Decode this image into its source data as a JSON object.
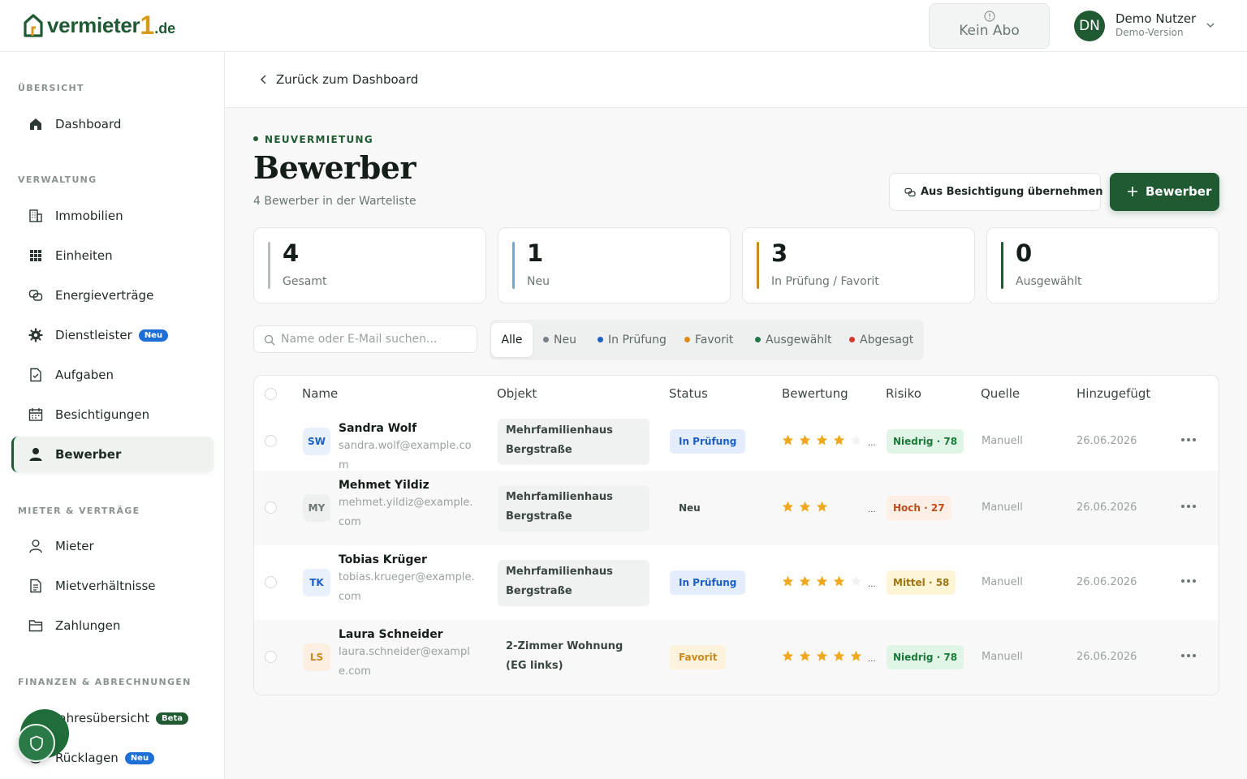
{
  "header": {
    "logo_text": "vermieter",
    "logo_one": "1",
    "logo_tld": ".de",
    "abo_label": "Kein Abo",
    "user_initials": "DN",
    "user_name": "Demo Nutzer",
    "user_role": "Demo-Version"
  },
  "sidebar": {
    "sections": {
      "overview": "ÜBERSICHT",
      "management": "VERWALTUNG",
      "tenants": "MIETER & VERTRÄGE",
      "finance": "FINANZEN & ABRECHNUNGEN"
    },
    "items": [
      {
        "label": "Dashboard",
        "icon": "home-icon"
      },
      {
        "label": "Immobilien",
        "icon": "building-icon"
      },
      {
        "label": "Einheiten",
        "icon": "grid-icon"
      },
      {
        "label": "Energieverträge",
        "icon": "energy-icon"
      },
      {
        "label": "Dienstleister",
        "icon": "gear-icon",
        "badge": "Neu"
      },
      {
        "label": "Aufgaben",
        "icon": "task-icon"
      },
      {
        "label": "Besichtigungen",
        "icon": "calendar-icon"
      },
      {
        "label": "Bewerber",
        "icon": "user-icon",
        "active": true
      },
      {
        "label": "Mieter",
        "icon": "user-outline-icon"
      },
      {
        "label": "Mietverhältnisse",
        "icon": "document-icon"
      },
      {
        "label": "Zahlungen",
        "icon": "folder-icon"
      },
      {
        "label": "Jahresübersicht",
        "icon": "chart-icon",
        "badge": "Beta"
      },
      {
        "label": "Rücklagen",
        "icon": "piggy-icon",
        "badge": "Neu"
      }
    ]
  },
  "back_link": "Zurück zum Dashboard",
  "page": {
    "eyebrow": "NEUVERMIETUNG",
    "title": "Bewerber",
    "subtitle": "4 Bewerber in der Warteliste",
    "btn_import": "Aus Besichtigung übernehmen",
    "btn_add": "Bewerber"
  },
  "stats": [
    {
      "value": "4",
      "label": "Gesamt",
      "color": "#b8bdb9"
    },
    {
      "value": "1",
      "label": "Neu",
      "color": "#7aa6c9"
    },
    {
      "value": "3",
      "label": "In Prüfung / Favorit",
      "color": "#c98a1e"
    },
    {
      "value": "0",
      "label": "Ausgewählt",
      "color": "#1f5a33"
    }
  ],
  "search": {
    "placeholder": "Name oder E-Mail suchen..."
  },
  "filters": [
    {
      "label": "Alle",
      "selected": true
    },
    {
      "label": "Neu",
      "dot": "#7a8088"
    },
    {
      "label": "In Prüfung",
      "dot": "#1d5fc2"
    },
    {
      "label": "Favorit",
      "dot": "#e08a1a"
    },
    {
      "label": "Ausgewählt",
      "dot": "#1f7a48"
    },
    {
      "label": "Abgesagt",
      "dot": "#d33a2c"
    }
  ],
  "table": {
    "headers": [
      "Name",
      "Objekt",
      "Status",
      "Bewertung",
      "Risiko",
      "Quelle",
      "Hinzugefügt"
    ],
    "rows": [
      {
        "initials": "SW",
        "name": "Sandra Wolf",
        "email": "sandra.wolf@example.com",
        "object": "Mehrfamilienhaus Bergstraße",
        "status": "In Prüfung",
        "rating": 4,
        "risk": "Niedrig · 78",
        "source": "Manuell",
        "date": "26.06.2026"
      },
      {
        "initials": "MY",
        "name": "Mehmet Yildiz",
        "email": "mehmet.yildiz@example.com",
        "object": "Mehrfamilienhaus Bergstraße",
        "status": "Neu",
        "rating": 3,
        "risk": "Hoch · 27",
        "source": "Manuell",
        "date": "26.06.2026"
      },
      {
        "initials": "TK",
        "name": "Tobias Krüger",
        "email": "tobias.krueger@example.com",
        "object": "Mehrfamilienhaus Bergstraße",
        "status": "In Prüfung",
        "rating": 4,
        "risk": "Mittel · 58",
        "source": "Manuell",
        "date": "26.06.2026"
      },
      {
        "initials": "LS",
        "name": "Laura Schneider",
        "email": "laura.schneider@example.com",
        "object": "2-Zimmer Wohnung (EG links)",
        "status": "Favorit",
        "rating": 5,
        "risk": "Niedrig · 78",
        "source": "Manuell",
        "date": "26.06.2026"
      }
    ]
  },
  "colors": {
    "brand": "#1f5a33",
    "accent": "#d99a1a"
  }
}
